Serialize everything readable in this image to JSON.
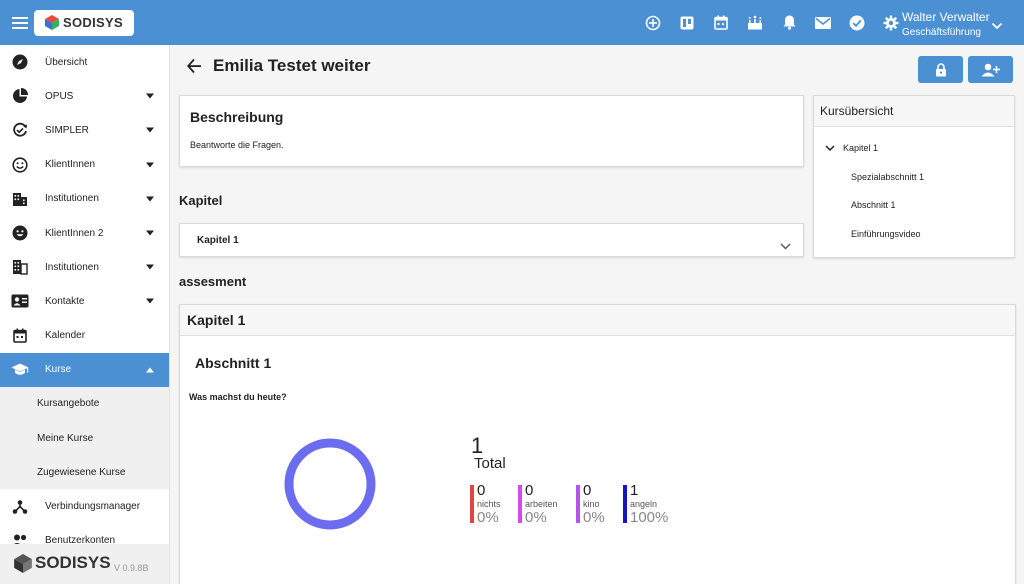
{
  "topbar": {
    "logo": "SODISYS",
    "icons": [
      "add-circle-icon",
      "board-icon",
      "calendar-icon",
      "birthday-icon",
      "bell-icon",
      "mail-icon",
      "check-circle-icon",
      "gear-icon"
    ],
    "user_name": "Walter Verwalter",
    "user_role": "Geschäftsführung"
  },
  "sidebar": {
    "items": [
      {
        "label": "Übersicht",
        "icon": "compass-icon",
        "caret": false,
        "active": false
      },
      {
        "label": "OPUS",
        "icon": "pie-chart-icon",
        "caret": true,
        "active": false
      },
      {
        "label": "SIMPLER",
        "icon": "refresh-check-icon",
        "caret": true,
        "active": false
      },
      {
        "label": "KlientInnen",
        "icon": "smiley-outline-icon",
        "caret": true,
        "active": false
      },
      {
        "label": "Institutionen",
        "icon": "buildings-icon",
        "caret": true,
        "active": false
      },
      {
        "label": "KlientInnen 2",
        "icon": "smiley-filled-icon",
        "caret": true,
        "active": false
      },
      {
        "label": "Institutionen",
        "icon": "building-icon",
        "caret": true,
        "active": false
      },
      {
        "label": "Kontakte",
        "icon": "contact-card-icon",
        "caret": true,
        "active": false
      },
      {
        "label": "Kalender",
        "icon": "calendar-icon",
        "caret": false,
        "active": false
      },
      {
        "label": "Kurse",
        "icon": "graduation-cap-icon",
        "caret": true,
        "active": true
      }
    ],
    "subitems": [
      "Kursangebote",
      "Meine Kurse",
      "Zugewiesene Kurse"
    ],
    "items_after": [
      {
        "label": "Verbindungsmanager",
        "icon": "hierarchy-icon"
      },
      {
        "label": "Benutzerkonten",
        "icon": "users-icon"
      }
    ],
    "footer_logo": "SODISYS",
    "version": "V 0.9.8B"
  },
  "page": {
    "title": "Emilia Testet weiter",
    "description_title": "Beschreibung",
    "description_text": "Beantworte die Fragen.",
    "kapitel_heading": "Kapitel",
    "kapitel_item": "Kapitel 1",
    "assessment_heading": "assesment",
    "assessment_card_title": "Kapitel 1",
    "abschnitt_title": "Abschnitt 1",
    "question": "Was machst du heute?"
  },
  "overview": {
    "title": "Kursübersicht",
    "chapter": "Kapitel 1",
    "sections": [
      "Spezialabschnitt 1",
      "Abschnitt 1",
      "Einführungsvideo"
    ]
  },
  "results": {
    "total": "1",
    "total_label": "Total",
    "donut_color": "#6c6cf0",
    "answers": [
      {
        "count": "0",
        "label": "nichts",
        "percent": "0%",
        "color": "#e0453f"
      },
      {
        "count": "0",
        "label": "arbeiten",
        "percent": "0%",
        "color": "#d648e8"
      },
      {
        "count": "0",
        "label": "kino",
        "percent": "0%",
        "color": "#b653e8"
      },
      {
        "count": "1",
        "label": "angeln",
        "percent": "100%",
        "color": "#1515c8"
      }
    ]
  },
  "colors": {
    "primary": "#4a90d2"
  }
}
